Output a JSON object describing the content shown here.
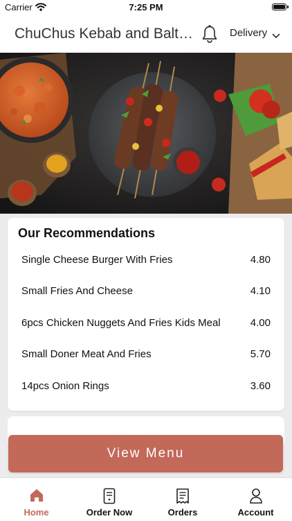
{
  "status_bar": {
    "carrier": "Carrier",
    "time": "7:25 PM"
  },
  "header": {
    "store_name": "ChuChus Kebab and Balti House",
    "delivery_label": "Delivery",
    "icons": [
      "bell-icon",
      "chevron-down-icon"
    ]
  },
  "hero": {
    "image": "kebab-skewers-banner"
  },
  "recommendations": {
    "title": "Our Recommendations",
    "items": [
      {
        "name": "Single Cheese Burger With Fries",
        "price": "4.80"
      },
      {
        "name": "Small Fries And Cheese",
        "price": "4.10"
      },
      {
        "name": "6pcs Chicken Nuggets And Fries Kids Meal",
        "price": "4.00"
      },
      {
        "name": "Small Doner Meat And Fries",
        "price": "5.70"
      },
      {
        "name": "14pcs Onion Rings",
        "price": "3.60"
      }
    ]
  },
  "view_menu_label": "View Menu",
  "tabbar": {
    "tabs": [
      {
        "label": "Home",
        "icon": "home-icon",
        "active": true
      },
      {
        "label": "Order Now",
        "icon": "order-document-icon",
        "active": false
      },
      {
        "label": "Orders",
        "icon": "receipt-icon",
        "active": false
      },
      {
        "label": "Account",
        "icon": "user-icon",
        "active": false
      }
    ]
  },
  "colors": {
    "accent": "#c2695a",
    "background": "#ececec",
    "card": "#ffffff"
  }
}
